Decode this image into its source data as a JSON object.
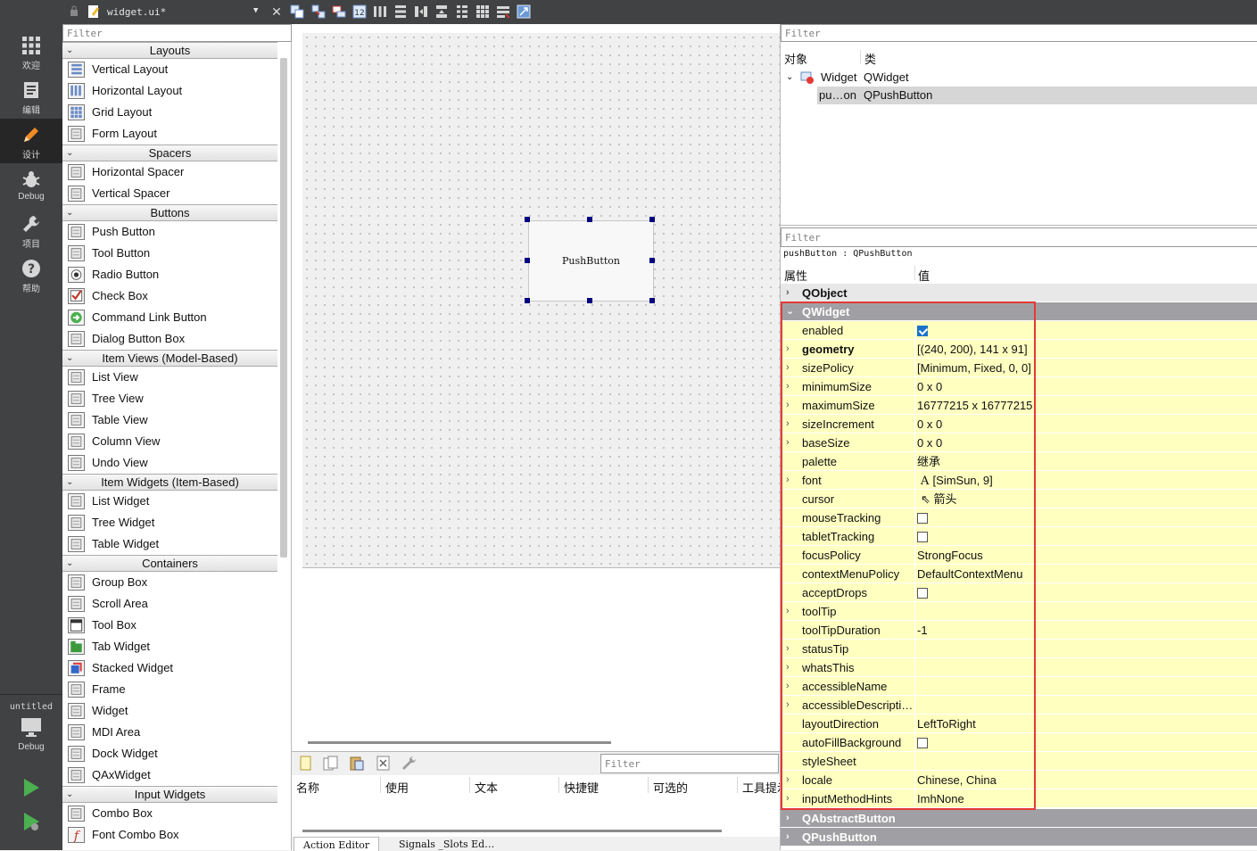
{
  "modes": [
    {
      "label": "欢迎",
      "icon": "grid-icon"
    },
    {
      "label": "编辑",
      "icon": "document-icon"
    },
    {
      "label": "设计",
      "icon": "pencil-icon",
      "active": true
    },
    {
      "label": "Debug",
      "icon": "bug-icon"
    },
    {
      "label": "项目",
      "icon": "wrench-icon"
    },
    {
      "label": "帮助",
      "icon": "help-icon"
    }
  ],
  "target": {
    "project": "untitled",
    "build": "Debug"
  },
  "file": {
    "name": "widget.ui*"
  },
  "widget_box": {
    "filter_placeholder": "Filter",
    "categories": [
      {
        "name": "Layouts",
        "items": [
          "Vertical Layout",
          "Horizontal Layout",
          "Grid Layout",
          "Form Layout"
        ]
      },
      {
        "name": "Spacers",
        "items": [
          "Horizontal Spacer",
          "Vertical Spacer"
        ]
      },
      {
        "name": "Buttons",
        "items": [
          "Push Button",
          "Tool Button",
          "Radio Button",
          "Check Box",
          "Command Link Button",
          "Dialog Button Box"
        ]
      },
      {
        "name": "Item Views (Model-Based)",
        "items": [
          "List View",
          "Tree View",
          "Table View",
          "Column View",
          "Undo View"
        ]
      },
      {
        "name": "Item Widgets (Item-Based)",
        "items": [
          "List Widget",
          "Tree Widget",
          "Table Widget"
        ]
      },
      {
        "name": "Containers",
        "items": [
          "Group Box",
          "Scroll Area",
          "Tool Box",
          "Tab Widget",
          "Stacked Widget",
          "Frame",
          "Widget",
          "MDI Area",
          "Dock Widget",
          "QAxWidget"
        ]
      },
      {
        "name": "Input Widgets",
        "items": [
          "Combo Box",
          "Font Combo Box"
        ]
      }
    ]
  },
  "form": {
    "push_button_text": "PushButton"
  },
  "action_editor": {
    "filter_placeholder": "Filter",
    "columns": [
      "名称",
      "使用",
      "文本",
      "快捷键",
      "可选的",
      "工具提示"
    ],
    "tabs": [
      "Action Editor",
      "Signals _Slots Ed…"
    ]
  },
  "object_inspector": {
    "filter_placeholder": "Filter",
    "col_object": "对象",
    "col_class": "类",
    "rows": [
      {
        "object": "Widget",
        "class": "QWidget"
      },
      {
        "object": "pu…on",
        "class": "QPushButton"
      }
    ]
  },
  "property_editor": {
    "filter_placeholder": "Filter",
    "object_line": "pushButton : QPushButton",
    "col_property": "属性",
    "col_value": "值",
    "groups": {
      "qobject": "QObject",
      "qwidget": "QWidget",
      "qabstractbutton": "QAbstractButton",
      "qpushbutton": "QPushButton"
    },
    "properties": [
      {
        "name": "enabled",
        "value": "",
        "checkbox": true,
        "checked": true
      },
      {
        "name": "geometry",
        "value": "[(240, 200), 141 x 91]",
        "expandable": true,
        "bold": true
      },
      {
        "name": "sizePolicy",
        "value": "[Minimum, Fixed, 0, 0]",
        "expandable": true
      },
      {
        "name": "minimumSize",
        "value": "0 x 0",
        "expandable": true
      },
      {
        "name": "maximumSize",
        "value": "16777215 x 16777215",
        "expandable": true
      },
      {
        "name": "sizeIncrement",
        "value": "0 x 0",
        "expandable": true
      },
      {
        "name": "baseSize",
        "value": "0 x 0",
        "expandable": true
      },
      {
        "name": "palette",
        "value": "继承"
      },
      {
        "name": "font",
        "value": "[SimSun, 9]",
        "expandable": true,
        "icon": "font-icon"
      },
      {
        "name": "cursor",
        "value": "箭头",
        "icon": "cursor-icon"
      },
      {
        "name": "mouseTracking",
        "value": "",
        "checkbox": true,
        "checked": false
      },
      {
        "name": "tabletTracking",
        "value": "",
        "checkbox": true,
        "checked": false
      },
      {
        "name": "focusPolicy",
        "value": "StrongFocus"
      },
      {
        "name": "contextMenuPolicy",
        "value": "DefaultContextMenu"
      },
      {
        "name": "acceptDrops",
        "value": "",
        "checkbox": true,
        "checked": false
      },
      {
        "name": "toolTip",
        "value": "",
        "expandable": true
      },
      {
        "name": "toolTipDuration",
        "value": "-1"
      },
      {
        "name": "statusTip",
        "value": "",
        "expandable": true
      },
      {
        "name": "whatsThis",
        "value": "",
        "expandable": true
      },
      {
        "name": "accessibleName",
        "value": "",
        "expandable": true
      },
      {
        "name": "accessibleDescripti…",
        "value": "",
        "expandable": true
      },
      {
        "name": "layoutDirection",
        "value": "LeftToRight"
      },
      {
        "name": "autoFillBackground",
        "value": "",
        "checkbox": true,
        "checked": false
      },
      {
        "name": "styleSheet",
        "value": ""
      },
      {
        "name": "locale",
        "value": "Chinese, China",
        "expandable": true
      },
      {
        "name": "inputMethodHints",
        "value": "ImhNone",
        "expandable": true
      }
    ]
  },
  "colors": {
    "highlight_box": "#e53935",
    "property_row": "#ffffc0",
    "group_row": "#a0a0a4",
    "selection_handle": "#000080"
  }
}
